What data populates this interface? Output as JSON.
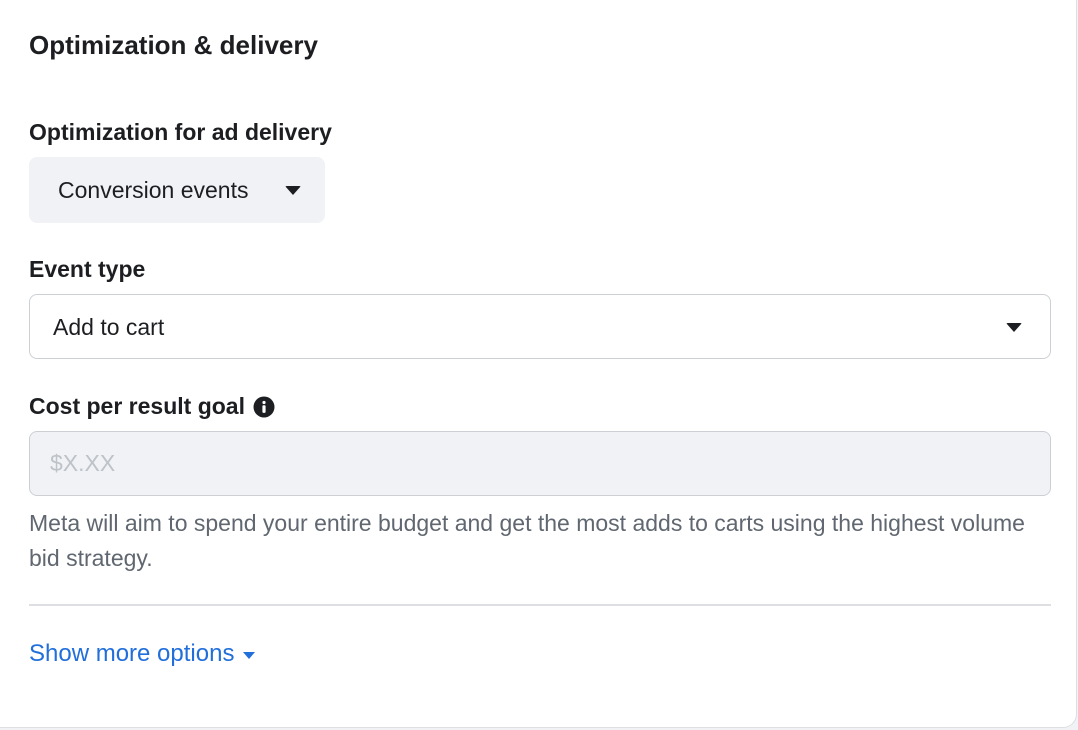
{
  "section": {
    "title": "Optimization & delivery"
  },
  "optimization": {
    "label": "Optimization for ad delivery",
    "selected": "Conversion events"
  },
  "event_type": {
    "label": "Event type",
    "selected": "Add to cart"
  },
  "cost_goal": {
    "label": "Cost per result goal",
    "placeholder": "$X.XX",
    "value": "",
    "help_text": "Meta will aim to spend your entire budget and get the most adds to carts using the highest volume bid strategy."
  },
  "show_more": {
    "label": "Show more options"
  },
  "colors": {
    "link": "#216fdb",
    "text": "#1c1e21",
    "muted": "#606770",
    "field_bg": "#f0f2f5",
    "border": "#ccd0d5"
  },
  "icons": {
    "info": "info-icon",
    "dropdown": "caret-down-icon"
  }
}
